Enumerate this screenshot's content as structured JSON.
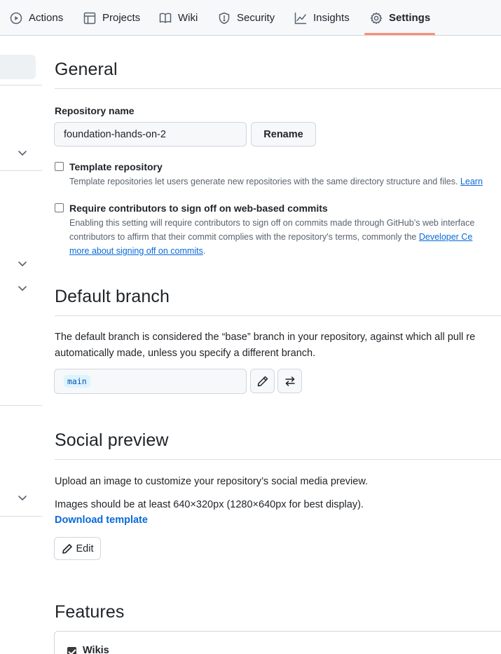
{
  "nav": {
    "tabs": [
      {
        "label": "Actions",
        "icon": "play-circle-icon"
      },
      {
        "label": "Projects",
        "icon": "table-icon"
      },
      {
        "label": "Wiki",
        "icon": "book-icon"
      },
      {
        "label": "Security",
        "icon": "shield-icon"
      },
      {
        "label": "Insights",
        "icon": "graph-icon"
      },
      {
        "label": "Settings",
        "icon": "gear-icon",
        "active": true
      }
    ],
    "active_color": "#fd8c73"
  },
  "general": {
    "heading": "General",
    "repo_name_label": "Repository name",
    "repo_name_value": "foundation-hands-on-2",
    "rename_button": "Rename",
    "template": {
      "label": "Template repository",
      "checked": false,
      "description": "Template repositories let users generate new repositories with the same directory structure and files.",
      "link": "Learn"
    },
    "signoff": {
      "label": "Require contributors to sign off on web-based commits",
      "checked": false,
      "line1": "Enabling this setting will require contributors to sign off on commits made through GitHub’s web interface",
      "line2_text": "contributors to affirm that their commit complies with the repository's terms, commonly the ",
      "line2_link": "Developer Ce",
      "line3_link": "more about signing off on commits",
      "line3_tail": "."
    }
  },
  "default_branch": {
    "heading": "Default branch",
    "line1": "The default branch is considered the “base” branch in your repository, against which all pull re",
    "line2": "automatically made, unless you specify a different branch.",
    "branch": "main"
  },
  "social_preview": {
    "heading": "Social preview",
    "line1": "Upload an image to customize your repository’s social media preview.",
    "line2": "Images should be at least 640×320px (1280×640px for best display).",
    "download_link": "Download template",
    "edit_button": "Edit"
  },
  "features": {
    "heading": "Features",
    "wikis_label": "Wikis",
    "wikis_checked": true
  },
  "colors": {
    "link": "#0969da",
    "border": "#d0d7de",
    "muted_text": "#59636e"
  }
}
